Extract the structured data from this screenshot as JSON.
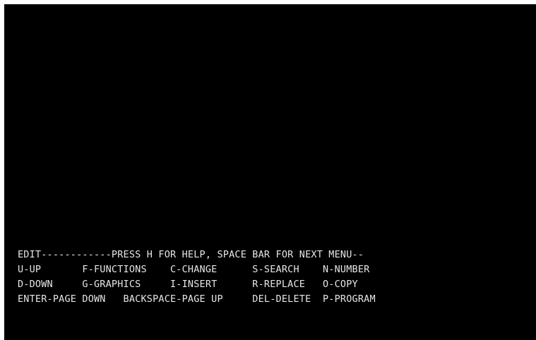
{
  "colors": {
    "screen_background": "#000000",
    "text": "#e6e6e6"
  },
  "menu": {
    "lines": [
      "EDIT------------PRESS H FOR HELP, SPACE BAR FOR NEXT MENU--",
      "U-UP       F-FUNCTIONS    C-CHANGE      S-SEARCH    N-NUMBER",
      "D-DOWN     G-GRAPHICS     I-INSERT      R-REPLACE   O-COPY",
      "ENTER-PAGE DOWN   BACKSPACE-PAGE UP     DEL-DELETE  P-PROGRAM"
    ]
  }
}
